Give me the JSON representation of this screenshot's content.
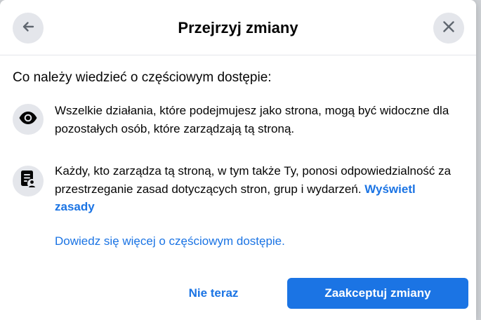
{
  "dialog": {
    "title": "Przejrzyj zmiany",
    "back_icon": "arrow-left-icon",
    "close_icon": "close-icon"
  },
  "content": {
    "heading": "Co należy wiedzieć o częściowym dostępie:",
    "items": [
      {
        "icon": "eye-icon",
        "text": "Wszelkie działania, które podejmujesz jako strona, mogą być widoczne dla pozostałych osób, które zarządzają tą stroną."
      },
      {
        "icon": "policy-document-icon",
        "text": "Każdy, kto zarządza tą stroną, w tym także Ty, ponosi odpowiedzialność za przestrzeganie zasad dotyczących stron, grup i wydarzeń.",
        "link_label": "Wyświetl zasady"
      }
    ],
    "learn_more": "Dowiedz się więcej o częściowym dostępie."
  },
  "footer": {
    "secondary_label": "Nie teraz",
    "primary_label": "Zaakceptuj zmiany"
  },
  "colors": {
    "accent": "#1b74e4",
    "icon_bg": "#e4e6eb",
    "text": "#050505"
  }
}
